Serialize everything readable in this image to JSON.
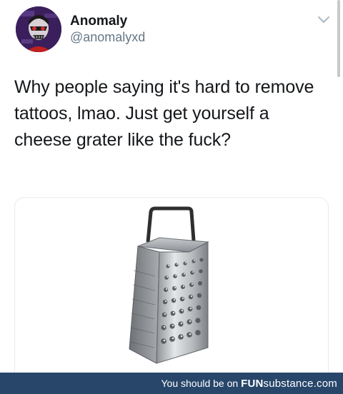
{
  "tweet": {
    "display_name": "Anomaly",
    "handle": "@anomalyxd",
    "text": "Why people saying it's hard to remove tattoos, lmao. Just get yourself a cheese grater like the fuck?",
    "menu_icon": "chevron-down-icon",
    "media_icon": "cheese-grater-image"
  },
  "footer": {
    "prefix": "You should be on",
    "brand_bold": "FUN",
    "brand_rest": "substance.com",
    "background": "#27466a"
  }
}
